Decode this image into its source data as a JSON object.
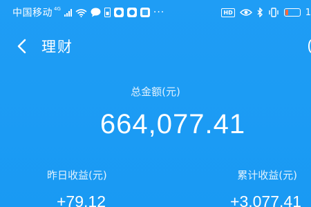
{
  "status_bar": {
    "carrier": "中国移动",
    "network": "4G",
    "more": "···",
    "hd": "HD",
    "battery_level": 0.2,
    "battery_pct": "1"
  },
  "nav": {
    "title": "理财"
  },
  "summary": {
    "total_label": "总金额(元)",
    "total_value": "664,077.41",
    "yesterday_label": "昨日收益(元)",
    "yesterday_value": "+79.12",
    "cumulative_label": "累计收益(元)",
    "cumulative_value": "+3,077.41"
  },
  "colors": {
    "background": "#1e9bf4",
    "text": "#ffffff",
    "battery": "#ff6a3d"
  }
}
